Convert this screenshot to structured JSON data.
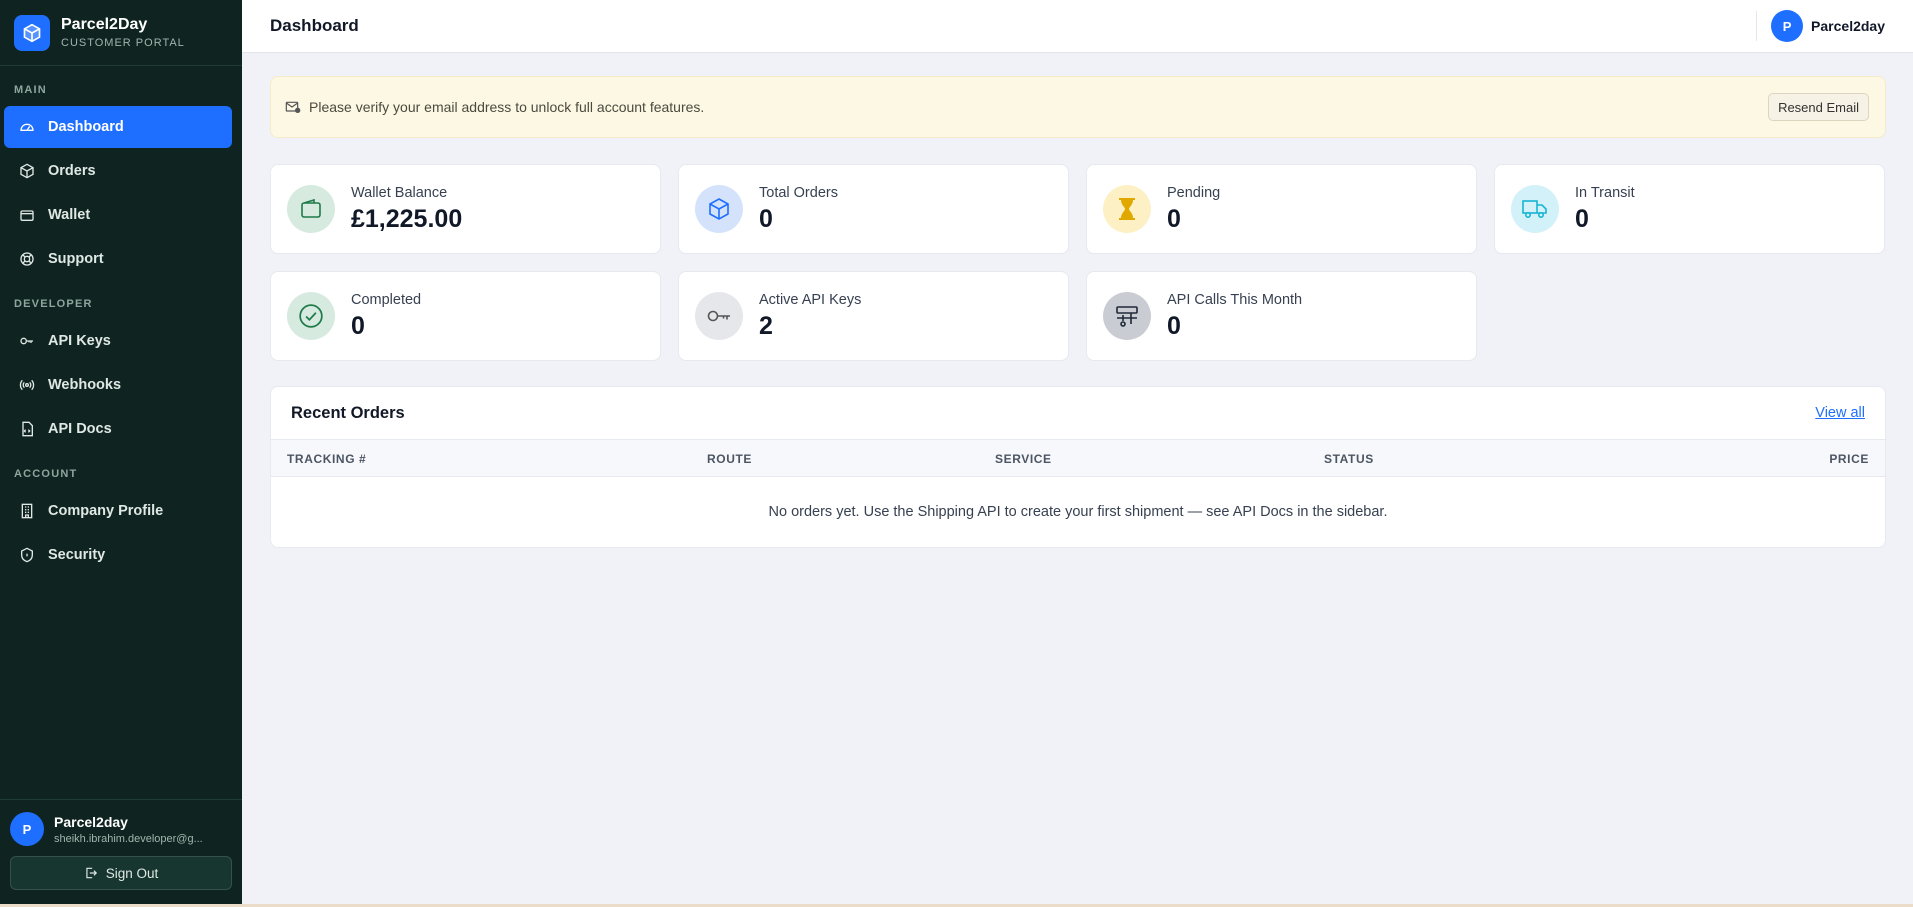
{
  "brand": {
    "name": "Parcel2Day",
    "subtitle": "CUSTOMER PORTAL"
  },
  "sidebar": {
    "sections": [
      {
        "label": "MAIN",
        "items": [
          {
            "label": "Dashboard",
            "icon": "gauge-icon",
            "active": true
          },
          {
            "label": "Orders",
            "icon": "box-icon"
          },
          {
            "label": "Wallet",
            "icon": "wallet-icon"
          },
          {
            "label": "Support",
            "icon": "lifebuoy-icon"
          }
        ]
      },
      {
        "label": "DEVELOPER",
        "items": [
          {
            "label": "API Keys",
            "icon": "key-icon"
          },
          {
            "label": "Webhooks",
            "icon": "broadcast-icon"
          },
          {
            "label": "API Docs",
            "icon": "file-code-icon"
          }
        ]
      },
      {
        "label": "ACCOUNT",
        "items": [
          {
            "label": "Company Profile",
            "icon": "building-icon"
          },
          {
            "label": "Security",
            "icon": "shield-icon"
          }
        ]
      }
    ],
    "user": {
      "initial": "P",
      "name": "Parcel2day",
      "email": "sheikh.ibrahim.developer@g..."
    },
    "signout_label": "Sign Out"
  },
  "header": {
    "title": "Dashboard",
    "user_initial": "P",
    "user_name": "Parcel2day"
  },
  "alert": {
    "message": "Please verify your email address to unlock full account features.",
    "button": "Resend Email"
  },
  "stats": [
    {
      "label": "Wallet Balance",
      "value": "£1,225.00",
      "icon": "wallet-icon",
      "bg": "#d6eadf",
      "color": "#1f7a4a"
    },
    {
      "label": "Total Orders",
      "value": "0",
      "icon": "box-icon",
      "bg": "#d4e3fb",
      "color": "#1e6fff"
    },
    {
      "label": "Pending",
      "value": "0",
      "icon": "hourglass-icon",
      "bg": "#fdf0c5",
      "color": "#e0a800"
    },
    {
      "label": "In Transit",
      "value": "0",
      "icon": "truck-icon",
      "bg": "#d3f1f8",
      "color": "#19b4d4"
    },
    {
      "label": "Completed",
      "value": "0",
      "icon": "check-circle-icon",
      "bg": "#d6eadf",
      "color": "#1f7a4a"
    },
    {
      "label": "Active API Keys",
      "value": "2",
      "icon": "key-icon",
      "bg": "#e5e7eb",
      "color": "#6b7280"
    },
    {
      "label": "API Calls This Month",
      "value": "0",
      "icon": "sliders-icon",
      "bg": "#c9cdd3",
      "color": "#1f2937"
    }
  ],
  "orders": {
    "title": "Recent Orders",
    "view_all": "View all",
    "columns": [
      "TRACKING #",
      "ROUTE",
      "SERVICE",
      "STATUS",
      "PRICE"
    ],
    "empty": "No orders yet. Use the Shipping API to create your first shipment — see API Docs in the sidebar."
  },
  "colors": {
    "sidebar_bg": "#0f2420",
    "accent": "#1e6fff",
    "alert_bg": "#fdf8e4"
  }
}
